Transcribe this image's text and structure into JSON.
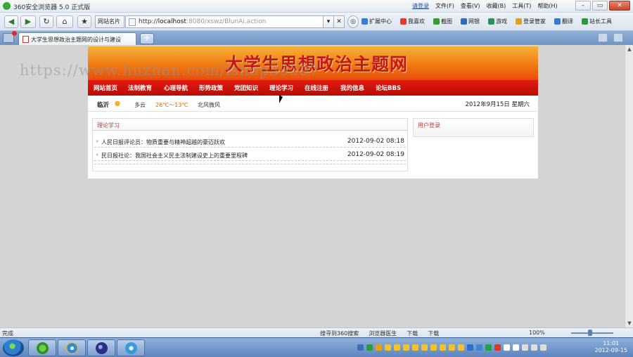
{
  "window": {
    "title": "360安全浏览器 5.0 正式版",
    "login_link": "请登录",
    "menu": [
      "文件(F)",
      "查看(V)",
      "收藏(B)",
      "工具(T)",
      "帮助(H)"
    ],
    "min": "–",
    "max": "▭",
    "close": "✕"
  },
  "toolbar": {
    "back": "◀",
    "forward": "▶",
    "refresh": "↻",
    "home": "⌂",
    "star": "★",
    "favorites": "网站名片",
    "url_prefix": "http://",
    "url_host": "localhost",
    "url_rest": ":8080/xswz/BlunAi.action",
    "dropdown": "▾",
    "stop": "✕",
    "tools": [
      "扩展中心",
      "我喜欢",
      "截图",
      "网银",
      "游戏",
      "登录管家",
      "翻译",
      "站长工具"
    ]
  },
  "tabs": {
    "active_title": "大学生思想政治主题网的设计与建设",
    "new_tab": "+"
  },
  "site": {
    "title": "大学生思想政治主题网",
    "nav": [
      "网站首页",
      "法制教育",
      "心理导航",
      "形势政策",
      "党团知识",
      "理论学习",
      "在线注册",
      "我的信息",
      "论坛BBS"
    ],
    "city": "临沂",
    "weather": "多云",
    "temperature": "26℃～13℃",
    "wind": "北风微风",
    "date": "2012年9月15日 星期六",
    "left_box_title": "理论学习",
    "right_box_title": "用户登录",
    "news": [
      {
        "title": "人民日报评论员：物质重要与精神超越的豪迈跃欢",
        "date": "2012-09-02 08:18"
      },
      {
        "title": "民日报社论：我国社会主义民主法制建设史上的重要里程碑",
        "date": "2012-09-02 08:19"
      }
    ]
  },
  "status": {
    "text": "完成",
    "items": [
      "搜寻到360搜索",
      "浏览器医生",
      "下载",
      "下载"
    ],
    "zoom": "100%"
  },
  "taskbar": {
    "time": "11:01",
    "date": "2012-09-15"
  },
  "watermark": "https://www.huzhan.com/ishop39397",
  "colors": {
    "nav_red": "#c8120a",
    "banner_orange": "#f07a12",
    "title_red": "#c4161c"
  }
}
